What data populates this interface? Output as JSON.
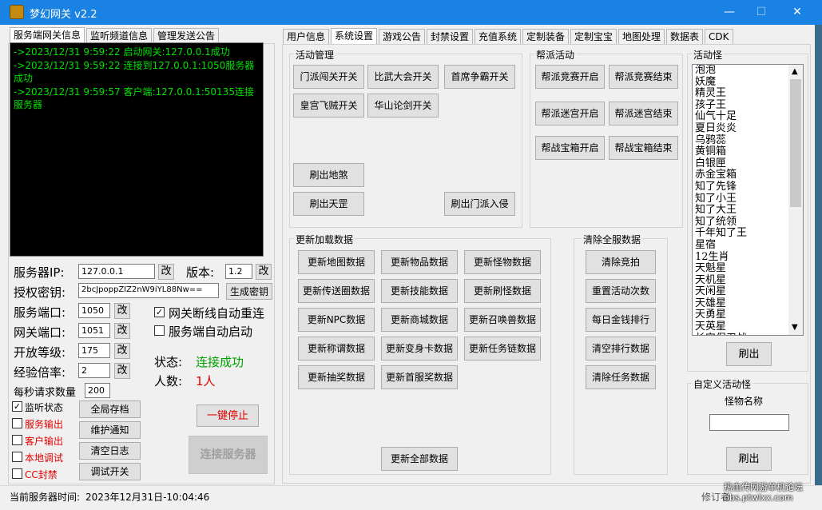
{
  "window": {
    "title": "梦幻网关 v2.2",
    "minimize": "—",
    "maximize": "☐",
    "close": "✕"
  },
  "left_tabs": [
    "服务端网关信息",
    "监听频道信息",
    "管理发送公告"
  ],
  "log_lines": [
    "->2023/12/31 9:59:22    启动网关:127.0.0.1成功",
    "->2023/12/31 9:59:22    连接到127.0.0.1:1050服务器成功",
    "->2023/12/31 9:59:57    客户端:127.0.0.1:50135连接服务器"
  ],
  "server": {
    "ip_label": "服务器IP:",
    "ip_value": "127.0.0.1",
    "ip_change": "改",
    "version_label": "版本:",
    "version_value": "1.2",
    "version_change": "改",
    "key_label": "授权密钥:",
    "key_value": "2bcJpoppZIZ2nW9iYL88Nw==",
    "gen_key": "生成密钥",
    "server_port_label": "服务端口:",
    "server_port_value": "1050",
    "server_port_change": "改",
    "gateway_port_label": "网关端口:",
    "gateway_port_value": "1051",
    "gateway_port_change": "改",
    "open_level_label": "开放等级:",
    "open_level_value": "175",
    "open_level_change": "改",
    "exp_rate_label": "经验倍率:",
    "exp_rate_value": "2",
    "exp_rate_change": "改",
    "req_label": "每秒请求数量",
    "req_value": "200",
    "auto_reconnect_label": "网关断线自动重连",
    "auto_reconnect_checked": true,
    "auto_start_label": "服务端自动启动",
    "auto_start_checked": false,
    "status_label": "状态:",
    "status_value": "连接成功",
    "people_label": "人数:",
    "people_value": "1人",
    "status_color": "#00a000",
    "people_color": "#e00000"
  },
  "checkboxes": [
    {
      "label": "监听状态",
      "checked": true,
      "color": "#000000"
    },
    {
      "label": "服务输出",
      "checked": false,
      "color": "#e00000"
    },
    {
      "label": "客户输出",
      "checked": false,
      "color": "#e00000"
    },
    {
      "label": "本地调试",
      "checked": false,
      "color": "#e00000"
    },
    {
      "label": "CC封禁",
      "checked": false,
      "color": "#e00000"
    }
  ],
  "left_buttons": [
    "全局存档",
    "维护通知",
    "清空日志",
    "调试开关"
  ],
  "stop_button": "一键停止",
  "connect_button": "连接服务器",
  "right_tabs": [
    "用户信息",
    "系统设置",
    "游戏公告",
    "封禁设置",
    "充值系统",
    "定制装备",
    "定制宝宝",
    "地图处理",
    "数据表",
    "CDK"
  ],
  "activity": {
    "title": "活动管理",
    "buttons": [
      "门派闯关开关",
      "比武大会开关",
      "首席争霸开关",
      "皇宫飞贼开关",
      "华山论剑开关",
      "刷出地煞",
      "刷出天罡",
      "刷出门派入侵"
    ]
  },
  "gang": {
    "title": "帮派活动",
    "buttons": [
      "帮派竞赛开启",
      "帮派竞赛结束",
      "帮派迷宫开启",
      "帮派迷宫结束",
      "帮战宝箱开启",
      "帮战宝箱结束"
    ]
  },
  "monster": {
    "title": "活动怪",
    "items": [
      "泡泡",
      "妖魔",
      "精灵王",
      "孩子王",
      "仙气十足",
      "夏日炎炎",
      "乌鸦蕊",
      "黄铜箱",
      "白银匣",
      "赤金宝箱",
      "知了先锋",
      "知了小王",
      "知了大王",
      "知了统领",
      "千年知了王",
      "星宿",
      "12生肖",
      "天魁星",
      "天机星",
      "天闲星",
      "天雄星",
      "天勇星",
      "天英星",
      "长安保卫战"
    ],
    "refresh": "刷出"
  },
  "reload": {
    "title": "更新加载数据",
    "buttons": [
      "更新地图数据",
      "更新物品数据",
      "更新怪物数据",
      "更新传送圈数据",
      "更新技能数据",
      "更新刷怪数据",
      "更新NPC数据",
      "更新商城数据",
      "更新召唤兽数据",
      "更新称谓数据",
      "更新变身卡数据",
      "更新任务链数据",
      "更新抽奖数据",
      "更新首服奖数据"
    ],
    "all": "更新全部数据"
  },
  "clear": {
    "title": "清除全服数据",
    "buttons": [
      "清除竞拍",
      "重置活动次数",
      "每日金钱排行",
      "清空排行数据",
      "清除任务数据"
    ]
  },
  "custom": {
    "title": "自定义活动怪",
    "name_label": "怪物名称",
    "name_value": "",
    "refresh": "刷出"
  },
  "statusbar": {
    "time_label": "当前服务器时间:",
    "time_value": "2023年12月31日-10:04:46",
    "right_text": "修订者:"
  },
  "watermark": "热血传网游单机论坛\nbbs.ptwlxx.com"
}
